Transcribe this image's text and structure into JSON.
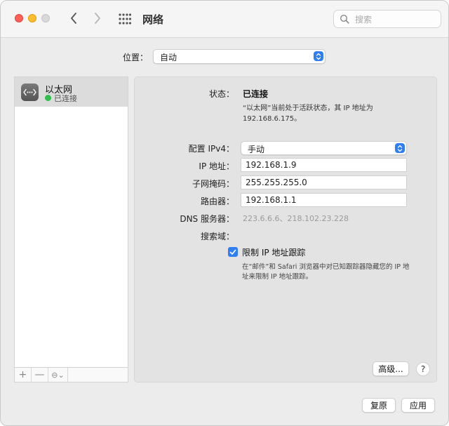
{
  "window": {
    "title": "网络"
  },
  "search": {
    "placeholder": "搜索"
  },
  "location": {
    "label": "位置：",
    "value": "自动"
  },
  "sidebar": {
    "services": [
      {
        "name": "以太网",
        "status": "已连接",
        "status_color": "#2fbf4a",
        "icon": "ethernet-icon"
      }
    ],
    "tools": {
      "add": "+",
      "remove": "—",
      "more": "⊖⌄"
    }
  },
  "detail": {
    "status_label": "状态：",
    "status_value": "已连接",
    "status_desc": "“以太网”当前处于活跃状态，其 IP 地址为 192.168.6.175。",
    "ipv4_label": "配置 IPv4：",
    "ipv4_value": "手动",
    "ip_label": "IP 地址：",
    "ip_value": "192.168.1.9",
    "mask_label": "子网掩码：",
    "mask_value": "255.255.255.0",
    "router_label": "路由器：",
    "router_value": "192.168.1.1",
    "dns_label": "DNS 服务器：",
    "dns_value": "223.6.6.6、218.102.23.228",
    "search_domain_label": "搜索域：",
    "limit_tracking_label": "限制 IP 地址跟踪",
    "limit_tracking_checked": true,
    "limit_tracking_desc": "在“邮件”和 Safari 浏览器中对已知跟踪器隐藏您的 IP 地址来限制 IP 地址跟踪。",
    "advanced_button": "高级...",
    "help_button": "?"
  },
  "footer": {
    "revert_button": "复原",
    "apply_button": "应用"
  },
  "colors": {
    "accent": "#2f7ef6",
    "connected": "#2fbf4a"
  }
}
